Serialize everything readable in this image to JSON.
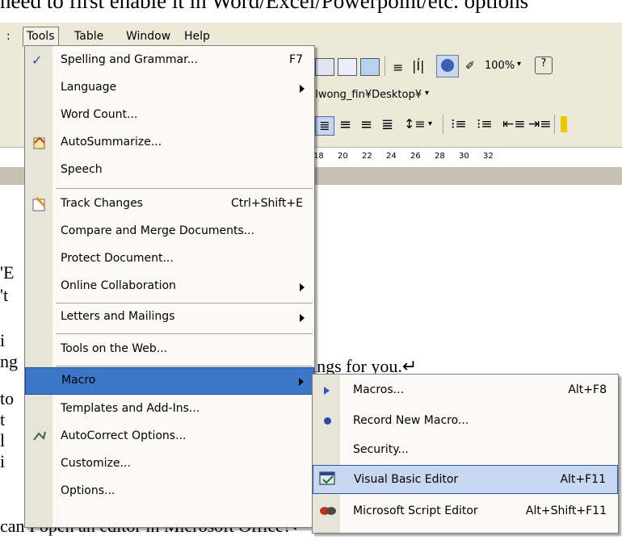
{
  "page": {
    "top_text": "need to first enable it in Word/Excel/Powerpoint/etc. options",
    "bottom_text": "can I open an editor in Microsoft Office?↵",
    "body_text_fragment": "ings for you.↵",
    "left_fragments": [
      "'E",
      "'t",
      "i",
      "ng",
      "to",
      "t",
      "l",
      "i"
    ]
  },
  "menubar": {
    "items": [
      {
        "label": "Tools",
        "underline": "T"
      },
      {
        "label": "Table",
        "underline": "a"
      },
      {
        "label": "Window",
        "underline": "W"
      },
      {
        "label": "Help",
        "underline": "H"
      }
    ]
  },
  "toolbar": {
    "zoom": "100%",
    "path": "nlwong_fin¥Desktop¥",
    "ruler_ticks": [
      "18",
      "20",
      "22",
      "24",
      "26",
      "28",
      "30",
      "32"
    ]
  },
  "tools_menu": {
    "items": [
      {
        "label": "Spelling and Grammar...",
        "shortcut": "F7",
        "icon": "spelling-icon"
      },
      {
        "label": "Language",
        "submenu": true
      },
      {
        "label": "Word Count..."
      },
      {
        "label": "AutoSummarize...",
        "icon": "autosummarize-icon"
      },
      {
        "label": "Speech"
      },
      {
        "label": "Track Changes",
        "shortcut": "Ctrl+Shift+E",
        "icon": "track-changes-icon"
      },
      {
        "label": "Compare and Merge Documents..."
      },
      {
        "label": "Protect Document..."
      },
      {
        "label": "Online Collaboration",
        "submenu": true
      },
      {
        "label": "Letters and Mailings",
        "submenu": true
      },
      {
        "label": "Tools on the Web..."
      },
      {
        "label": "Macro",
        "submenu": true,
        "highlighted": true
      },
      {
        "label": "Templates and Add-Ins..."
      },
      {
        "label": "AutoCorrect Options...",
        "icon": "autocorrect-icon"
      },
      {
        "label": "Customize..."
      },
      {
        "label": "Options..."
      }
    ]
  },
  "macro_submenu": {
    "items": [
      {
        "label": "Macros...",
        "shortcut": "Alt+F8",
        "icon": "play-icon"
      },
      {
        "label": "Record New Macro...",
        "icon": "record-icon"
      },
      {
        "label": "Security..."
      },
      {
        "label": "Visual Basic Editor",
        "shortcut": "Alt+F11",
        "icon": "vbe-icon",
        "highlighted": true
      },
      {
        "label": "Microsoft Script Editor",
        "shortcut": "Alt+Shift+F11",
        "icon": "script-editor-icon"
      }
    ]
  },
  "colors": {
    "menu_bg": "#fbfaf6",
    "gutter": "#e7e4d8",
    "highlight": "#3b76c9",
    "vbe_highlight": "#c7d7f2",
    "toolbar_bg": "#ece9d8"
  }
}
